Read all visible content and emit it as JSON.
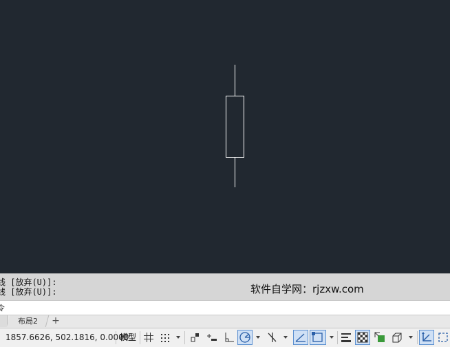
{
  "history": {
    "line1": "线 [放弃(U)]:",
    "line2": "线 [放弃(U)]:"
  },
  "watermark": "软件自学网：rjzxw.com",
  "command_prompt": "令",
  "tabs": {
    "layout2": "布局2",
    "add": "+"
  },
  "status": {
    "coordinates": "1857.6626, 502.1816, 0.0000",
    "model": "模型"
  },
  "colors": {
    "canvas_background": "#212830",
    "drawing_stroke": "#ffffff",
    "active_toggle": "#3a78c8"
  },
  "icons": [
    "grid-icon",
    "snap-grid-icon",
    "dropdown-arrow-icon",
    "infer-constraints-icon",
    "dynamic-input-icon",
    "ortho-icon",
    "polar-tracking-icon",
    "isodraft-icon",
    "object-snap-tracking-icon",
    "object-snap-icon",
    "lineweight-icon",
    "transparency-icon",
    "selection-cycling-icon",
    "3d-object-snap-icon",
    "dynamic-ucs-icon",
    "selection-filter-icon"
  ]
}
